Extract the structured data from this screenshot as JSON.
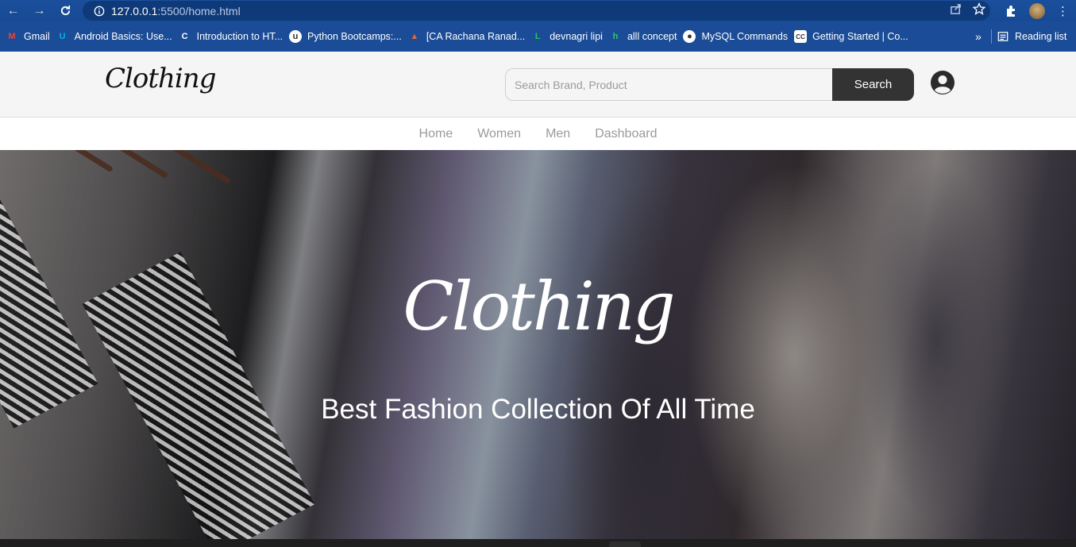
{
  "browser": {
    "url_host": "127.0.0.1",
    "url_path": ":5500/home.html",
    "bookmarks": [
      {
        "label": "Gmail",
        "icon": "gmail-icon",
        "color": "#ea4335",
        "glyph": "M"
      },
      {
        "label": "Android Basics: Use...",
        "icon": "udacity-icon",
        "color": "#02b3e4",
        "glyph": "U"
      },
      {
        "label": "Introduction to HT...",
        "icon": "codecademy-icon",
        "color": "#ffffff",
        "glyph": "C"
      },
      {
        "label": "Python Bootcamps:...",
        "icon": "udemy-icon",
        "color": "#ffffff",
        "glyph": "u"
      },
      {
        "label": "[CA Rachana Ranad...",
        "icon": "flame-icon",
        "color": "#e0663c",
        "glyph": "▲"
      },
      {
        "label": "devnagri lipi",
        "icon": "bracket-icon",
        "color": "#22c55e",
        "glyph": "L"
      },
      {
        "label": "alll concept",
        "icon": "hackerrank-icon",
        "color": "#2ec866",
        "glyph": "h"
      },
      {
        "label": "MySQL Commands",
        "icon": "globe-icon",
        "color": "#ffffff",
        "glyph": "●"
      },
      {
        "label": "Getting Started | Co...",
        "icon": "cc-icon",
        "color": "#ffffff",
        "glyph": "CC"
      }
    ],
    "more_label": "»",
    "reading_list_label": "Reading list"
  },
  "header": {
    "logo_text": "Clothing",
    "search_placeholder": "Search Brand, Product",
    "search_button": "Search"
  },
  "nav": {
    "items": [
      "Home",
      "Women",
      "Men",
      "Dashboard"
    ]
  },
  "hero": {
    "logo_text": "Clothing",
    "tagline": "Best Fashion Collection Of All Time"
  }
}
